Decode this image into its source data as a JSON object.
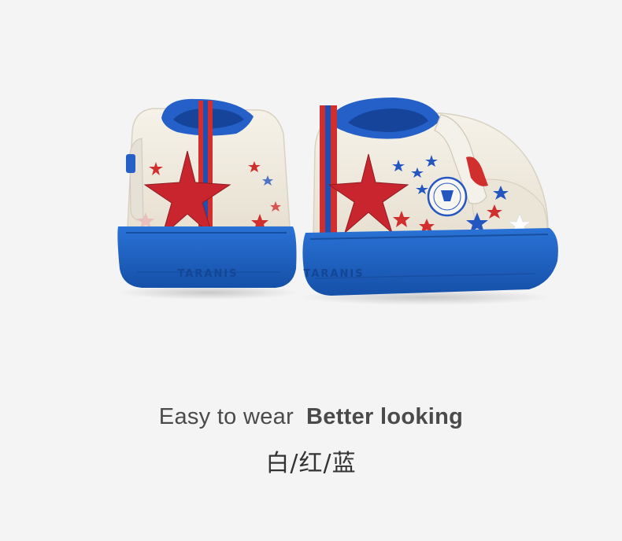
{
  "photo": {
    "subject_icon": "shoe-pair-photo",
    "colors": {
      "upper": "#f1ece1",
      "sole": "#1f66c9",
      "sole_dark": "#1550a8",
      "red": "#d12e2e",
      "blue_star": "#2456c0",
      "background": "#f4f4f4"
    },
    "sole_brand_left": "TARANIS",
    "sole_brand_right": "TARANIS"
  },
  "tagline": {
    "light": "Easy to wear",
    "bold": "Better looking"
  },
  "colors_text": "白/红/蓝"
}
